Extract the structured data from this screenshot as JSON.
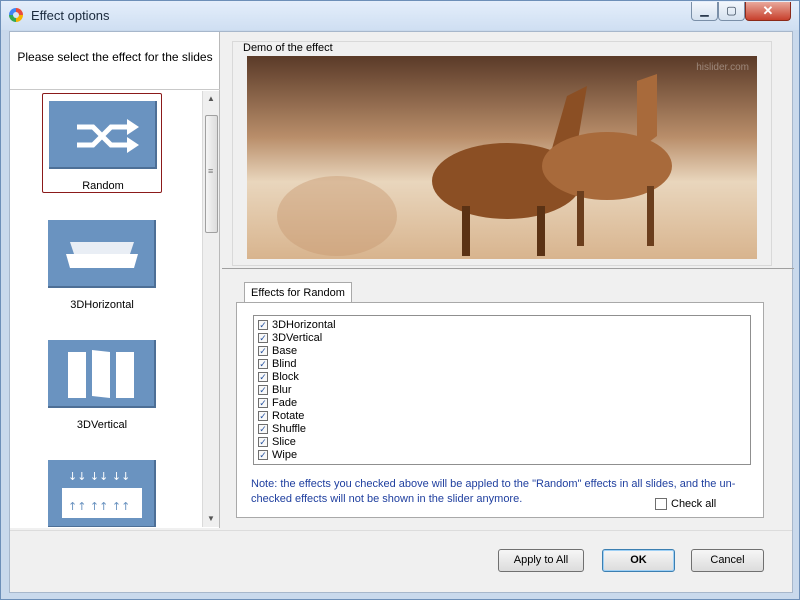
{
  "window": {
    "title": "Effect options"
  },
  "left_panel": {
    "heading": "Please select the effect for the slides",
    "effects": [
      {
        "label": "Random",
        "icon": "shuffle-icon",
        "selected": true
      },
      {
        "label": "3DHorizontal",
        "icon": "3d-horizontal-icon",
        "selected": false
      },
      {
        "label": "3DVertical",
        "icon": "3d-vertical-icon",
        "selected": false
      },
      {
        "label": "",
        "icon": "blind-icon",
        "selected": false
      }
    ]
  },
  "demo": {
    "label": "Demo of the effect",
    "watermark": "hislider.com"
  },
  "tab": {
    "label": "Effects for Random"
  },
  "effects_list": [
    {
      "label": "3DHorizontal",
      "checked": true
    },
    {
      "label": "3DVertical",
      "checked": true
    },
    {
      "label": "Base",
      "checked": true
    },
    {
      "label": "Blind",
      "checked": true
    },
    {
      "label": "Block",
      "checked": true
    },
    {
      "label": "Blur",
      "checked": true
    },
    {
      "label": "Fade",
      "checked": true
    },
    {
      "label": "Rotate",
      "checked": true
    },
    {
      "label": "Shuffle",
      "checked": true
    },
    {
      "label": "Slice",
      "checked": true
    },
    {
      "label": "Wipe",
      "checked": true
    }
  ],
  "note": "Note: the effects you checked above will be appled to the \"Random\"  effects in all slides, and the un-checked effects will not be shown in the slider anymore.",
  "check_all": {
    "label": "Check all",
    "checked": false
  },
  "buttons": {
    "apply_all": "Apply to All",
    "ok": "OK",
    "cancel": "Cancel"
  },
  "colors": {
    "thumb": "#6a93c0",
    "note_text": "#1f3f9f",
    "selected_border": "#8b1a1a"
  }
}
